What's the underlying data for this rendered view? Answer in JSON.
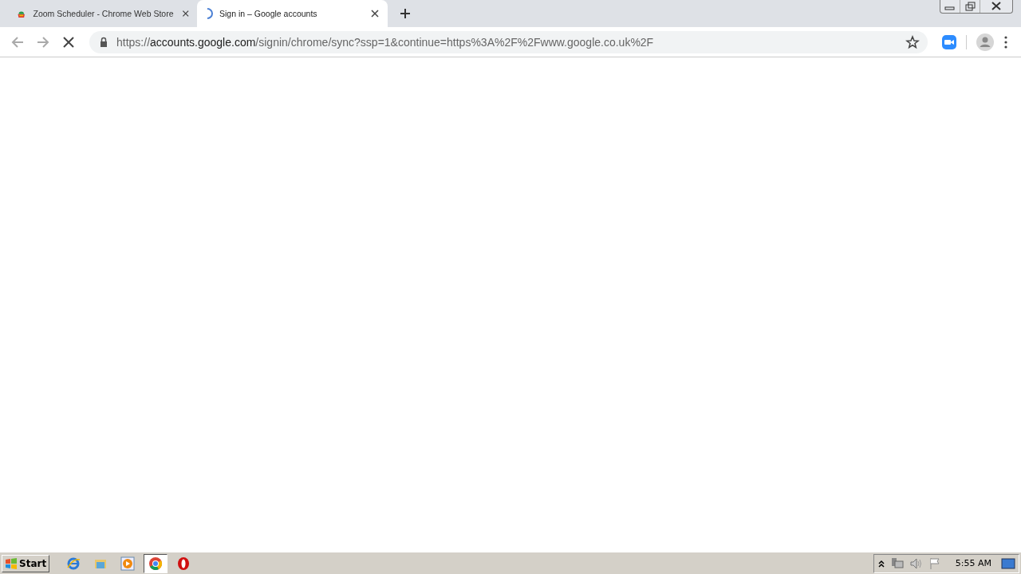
{
  "tabs": [
    {
      "title": "Zoom Scheduler - Chrome Web Store",
      "selected": false,
      "loading": false
    },
    {
      "title": "Sign in – Google accounts",
      "selected": true,
      "loading": true
    }
  ],
  "toolbar": {
    "loading": true
  },
  "address_bar": {
    "scheme": "https://",
    "host": "accounts.google.com",
    "path": "/signin/chrome/sync?ssp=1&continue=https%3A%2F%2Fwww.google.co.uk%2F"
  },
  "taskbar": {
    "start_label": "Start",
    "apps": [
      {
        "kind": "ie",
        "selected": false
      },
      {
        "kind": "folder",
        "selected": false
      },
      {
        "kind": "media",
        "selected": false
      },
      {
        "kind": "chrome",
        "selected": true
      },
      {
        "kind": "opera",
        "selected": false
      }
    ],
    "clock": "5:55 AM"
  }
}
